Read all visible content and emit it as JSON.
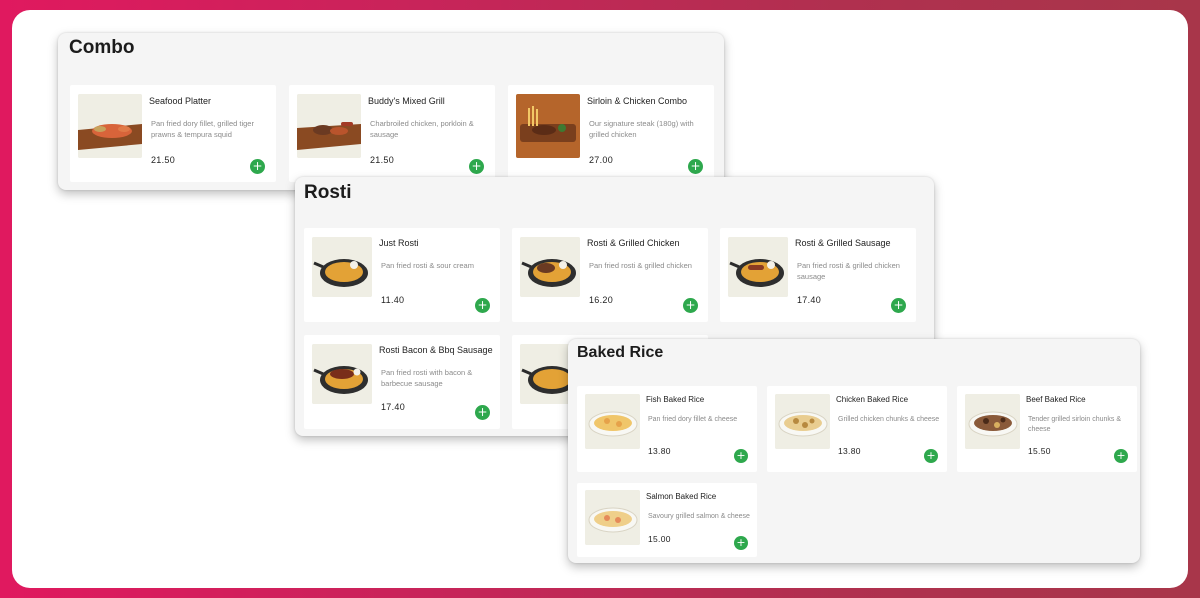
{
  "combo": {
    "title": "Combo",
    "items": [
      {
        "name": "Seafood Platter",
        "desc": "Pan fried dory fillet, grilled tiger prawns & tempura squid",
        "price": "21.50",
        "add": "+"
      },
      {
        "name": "Buddy's Mixed Grill",
        "desc": "Charbroiled chicken, porkloin & sausage",
        "price": "21.50",
        "add": "+"
      },
      {
        "name": "Sirloin & Chicken Combo",
        "desc": "Our signature steak (180g) with grilled chicken",
        "price": "27.00",
        "add": "+"
      }
    ]
  },
  "rosti": {
    "title": "Rosti",
    "items": [
      {
        "name": "Just Rosti",
        "desc": "Pan fried rosti & sour cream",
        "price": "11.40",
        "add": "+"
      },
      {
        "name": "Rosti & Grilled Chicken",
        "desc": "Pan fried rosti & grilled chicken",
        "price": "16.20",
        "add": "+"
      },
      {
        "name": "Rosti & Grilled Sausage",
        "desc": "Pan fried rosti & grilled chicken sausage",
        "price": "17.40",
        "add": "+"
      },
      {
        "name": "Rosti Bacon & Bbq Sausage",
        "desc": "Pan fried rosti with bacon & barbecue sausage",
        "price": "17.40",
        "add": "+"
      }
    ]
  },
  "baked_rice": {
    "title": "Baked Rice",
    "items": [
      {
        "name": "Fish Baked Rice",
        "desc": "Pan fried dory fillet & cheese",
        "price": "13.80",
        "add": "+"
      },
      {
        "name": "Chicken Baked Rice",
        "desc": "Grilled chicken chunks & cheese",
        "price": "13.80",
        "add": "+"
      },
      {
        "name": "Beef Baked Rice",
        "desc": "Tender grilled sirloin chunks & cheese",
        "price": "15.50",
        "add": "+"
      },
      {
        "name": "Salmon Baked Rice",
        "desc": "Savoury grilled salmon & cheese",
        "price": "15.00",
        "add": "+"
      }
    ]
  },
  "colors": {
    "accent": "#2ea84d",
    "background_gradient_start": "#e0195f",
    "panel": "#f5f5f5"
  }
}
